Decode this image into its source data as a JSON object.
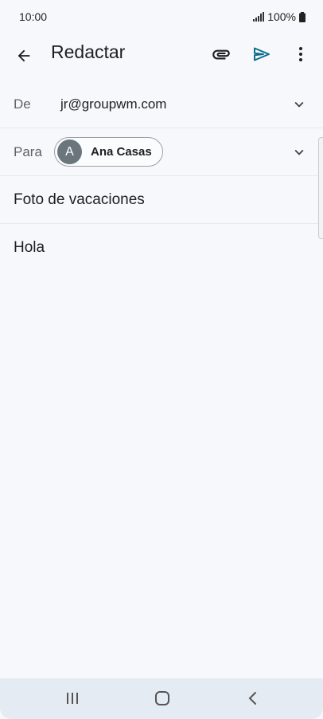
{
  "status_bar": {
    "time": "10:00",
    "battery": "100%"
  },
  "app_bar": {
    "title": "Redactar",
    "back_icon": "arrow-left-icon",
    "attach_icon": "paperclip-icon",
    "send_icon": "send-icon",
    "more_icon": "more-vert-icon"
  },
  "compose": {
    "from_label": "De",
    "from_value": "jr@groupwm.com",
    "to_label": "Para",
    "recipient": {
      "initial": "A",
      "name": "Ana Casas"
    },
    "subject": "Foto de vacaciones",
    "body": "Hola"
  },
  "colors": {
    "accent": "#0b6e8a",
    "avatar": "#6b757c",
    "background": "#f7f8fc",
    "nav_bar": "#e4ebf3"
  }
}
